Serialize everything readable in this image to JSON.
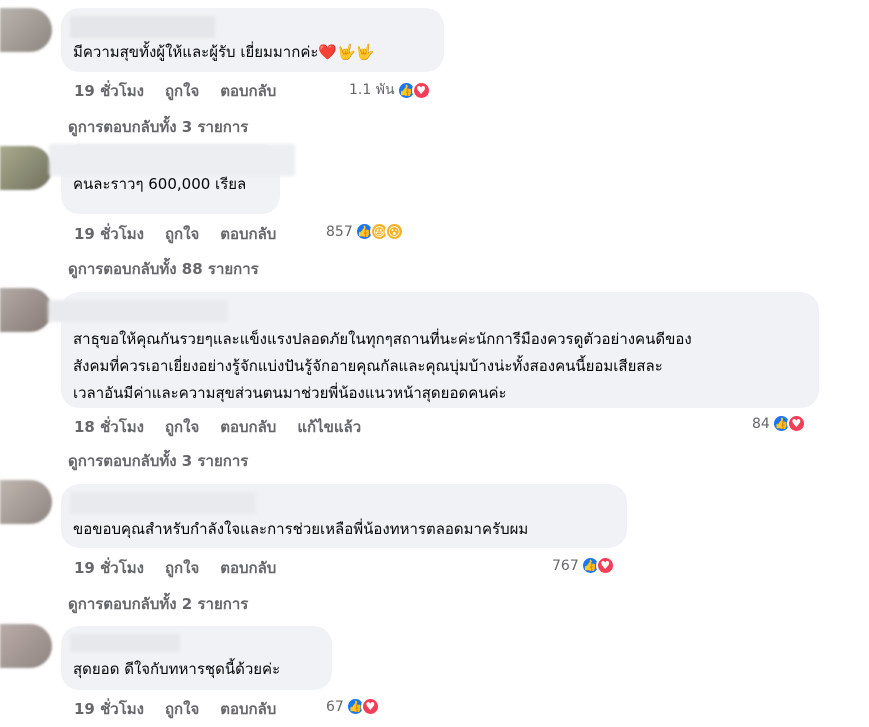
{
  "comments": [
    {
      "text": "มีความสุขทั้งผู้ให้และผู้รับ เยี่ยมมากค่ะ❤️🤟🤟",
      "time": "19 ชั่วโมง",
      "like": "ถูกใจ",
      "reply": "ตอบกลับ",
      "reaction_count": "1.1 พัน",
      "reactions": [
        "like-icon",
        "love-icon"
      ],
      "view_replies": "ดูการตอบกลับทั้ง 3 รายการ"
    },
    {
      "author_partial": "ออกพระ เกรียงไกรสงคราม",
      "text": "คนละราวๆ 600,000 เรียล",
      "time": "19 ชั่วโมง",
      "like": "ถูกใจ",
      "reply": "ตอบกลับ",
      "reaction_count": "857",
      "reactions": [
        "like-icon",
        "haha-icon",
        "wow-icon"
      ],
      "view_replies": "ดูการตอบกลับทั้ง 88 รายการ"
    },
    {
      "text": "สาธุขอให้คุณกันรวยๆและแข็งแรงปลอดภัยในทุกๆสถานที่นะค่ะนักการีมืองควรดูตัวอย่างคนดีของ\nสังคมที่ควรเอาเยี่ยงอย่างรู้จักแบ่งปันรู้จักอายคุณกัลและคุณบุ่มบ้างน่ะทั้งสองคนนี้ยอมเสียสละ\nเวลาอันมีค่าและความสุขส่วนตนมาช่วยพี่น้องแนวหน้าสุดยอดคนค่ะ",
      "time": "18 ชั่วโมง",
      "like": "ถูกใจ",
      "reply": "ตอบกลับ",
      "edited": "แก้ไขแล้ว",
      "reaction_count": "84",
      "reactions": [
        "like-icon",
        "love-icon"
      ],
      "view_replies": "ดูการตอบกลับทั้ง 3 รายการ"
    },
    {
      "text": "ขอขอบคุณสำหรับกำลังใจและการช่วยเหลือพี่น้องทหารตลอดมาครับผม",
      "time": "19 ชั่วโมง",
      "like": "ถูกใจ",
      "reply": "ตอบกลับ",
      "reaction_count": "767",
      "reactions": [
        "like-icon",
        "love-icon"
      ],
      "view_replies": "ดูการตอบกลับทั้ง 2 รายการ"
    },
    {
      "author_partial": "Tip Peerot",
      "text": "สุดยอด ดีใจกับทหารชุดนี้ด้วยค่ะ",
      "time": "19 ชั่วโมง",
      "like": "ถูกใจ",
      "reply": "ตอบกลับ",
      "reaction_count": "67",
      "reactions": [
        "like-icon",
        "love-icon"
      ]
    }
  ]
}
